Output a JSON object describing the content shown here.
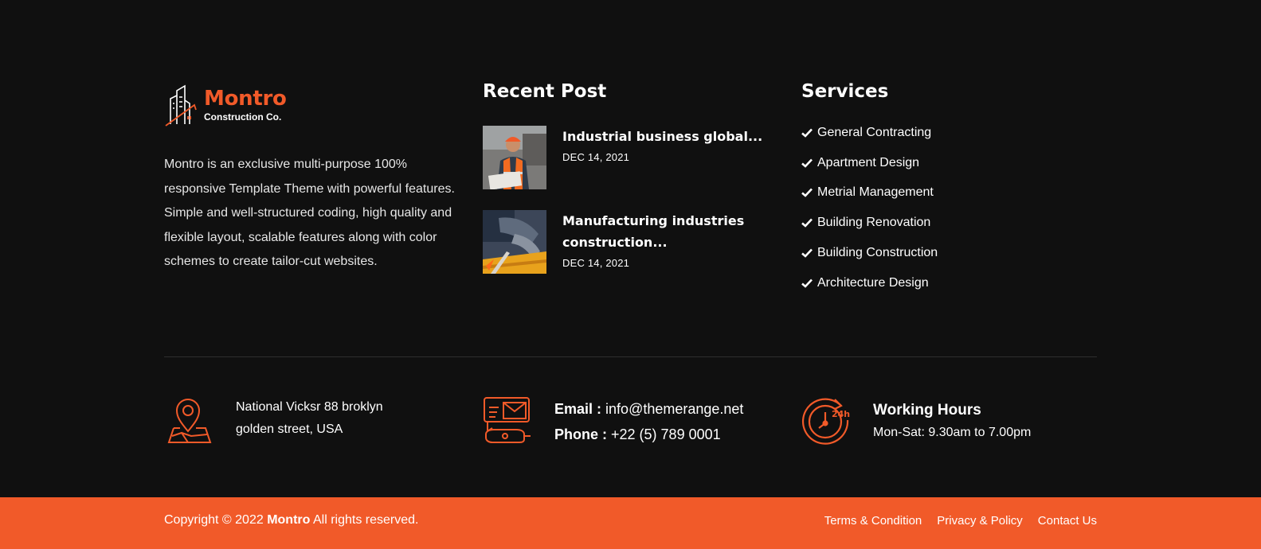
{
  "brand": {
    "name": "Montro",
    "tagline": "Construction Co.",
    "accent_color": "#f15a29",
    "background_color": "#101010"
  },
  "about": {
    "text": "Montro is an exclusive multi-purpose 100% responsive Template Theme with powerful features. Simple and well-structured coding, high quality and flexible layout, scalable features along with color schemes to create tailor-cut websites."
  },
  "recent_posts": {
    "title": "Recent Post",
    "items": [
      {
        "title": "Industrial business global...",
        "date": "DEC 14, 2021",
        "thumb": "worker-in-safety-vest-photo"
      },
      {
        "title": "Manufacturing industries construction...",
        "date": "DEC 14, 2021",
        "thumb": "welder-hands-photo"
      }
    ]
  },
  "services": {
    "title": "Services",
    "icon": "check-icon",
    "items": [
      "General Contracting",
      "Apartment Design",
      "Metrial Management",
      "Building Renovation",
      "Building Construction",
      "Architecture Design"
    ]
  },
  "contact": {
    "address": {
      "icon": "location-pin-map-icon",
      "line1": "National Vicksr 88 broklyn",
      "line2": "golden street, USA"
    },
    "mail": {
      "icon": "mail-phone-icon",
      "email_label": "Email :",
      "email_value": "info@themerange.net",
      "phone_label": "Phone :",
      "phone_value": "+22 (5) 789 0001"
    },
    "hours": {
      "icon": "clock-24h-icon",
      "title": "Working Hours",
      "text": "Mon-Sat: 9.30am to 7.00pm"
    }
  },
  "bottom_bar": {
    "copyright_prefix": "Copyright © 2022",
    "copyright_brand": "Montro",
    "copyright_suffix": "All rights reserved.",
    "links": [
      "Terms & Condition",
      "Privacy & Policy",
      "Contact Us"
    ]
  }
}
